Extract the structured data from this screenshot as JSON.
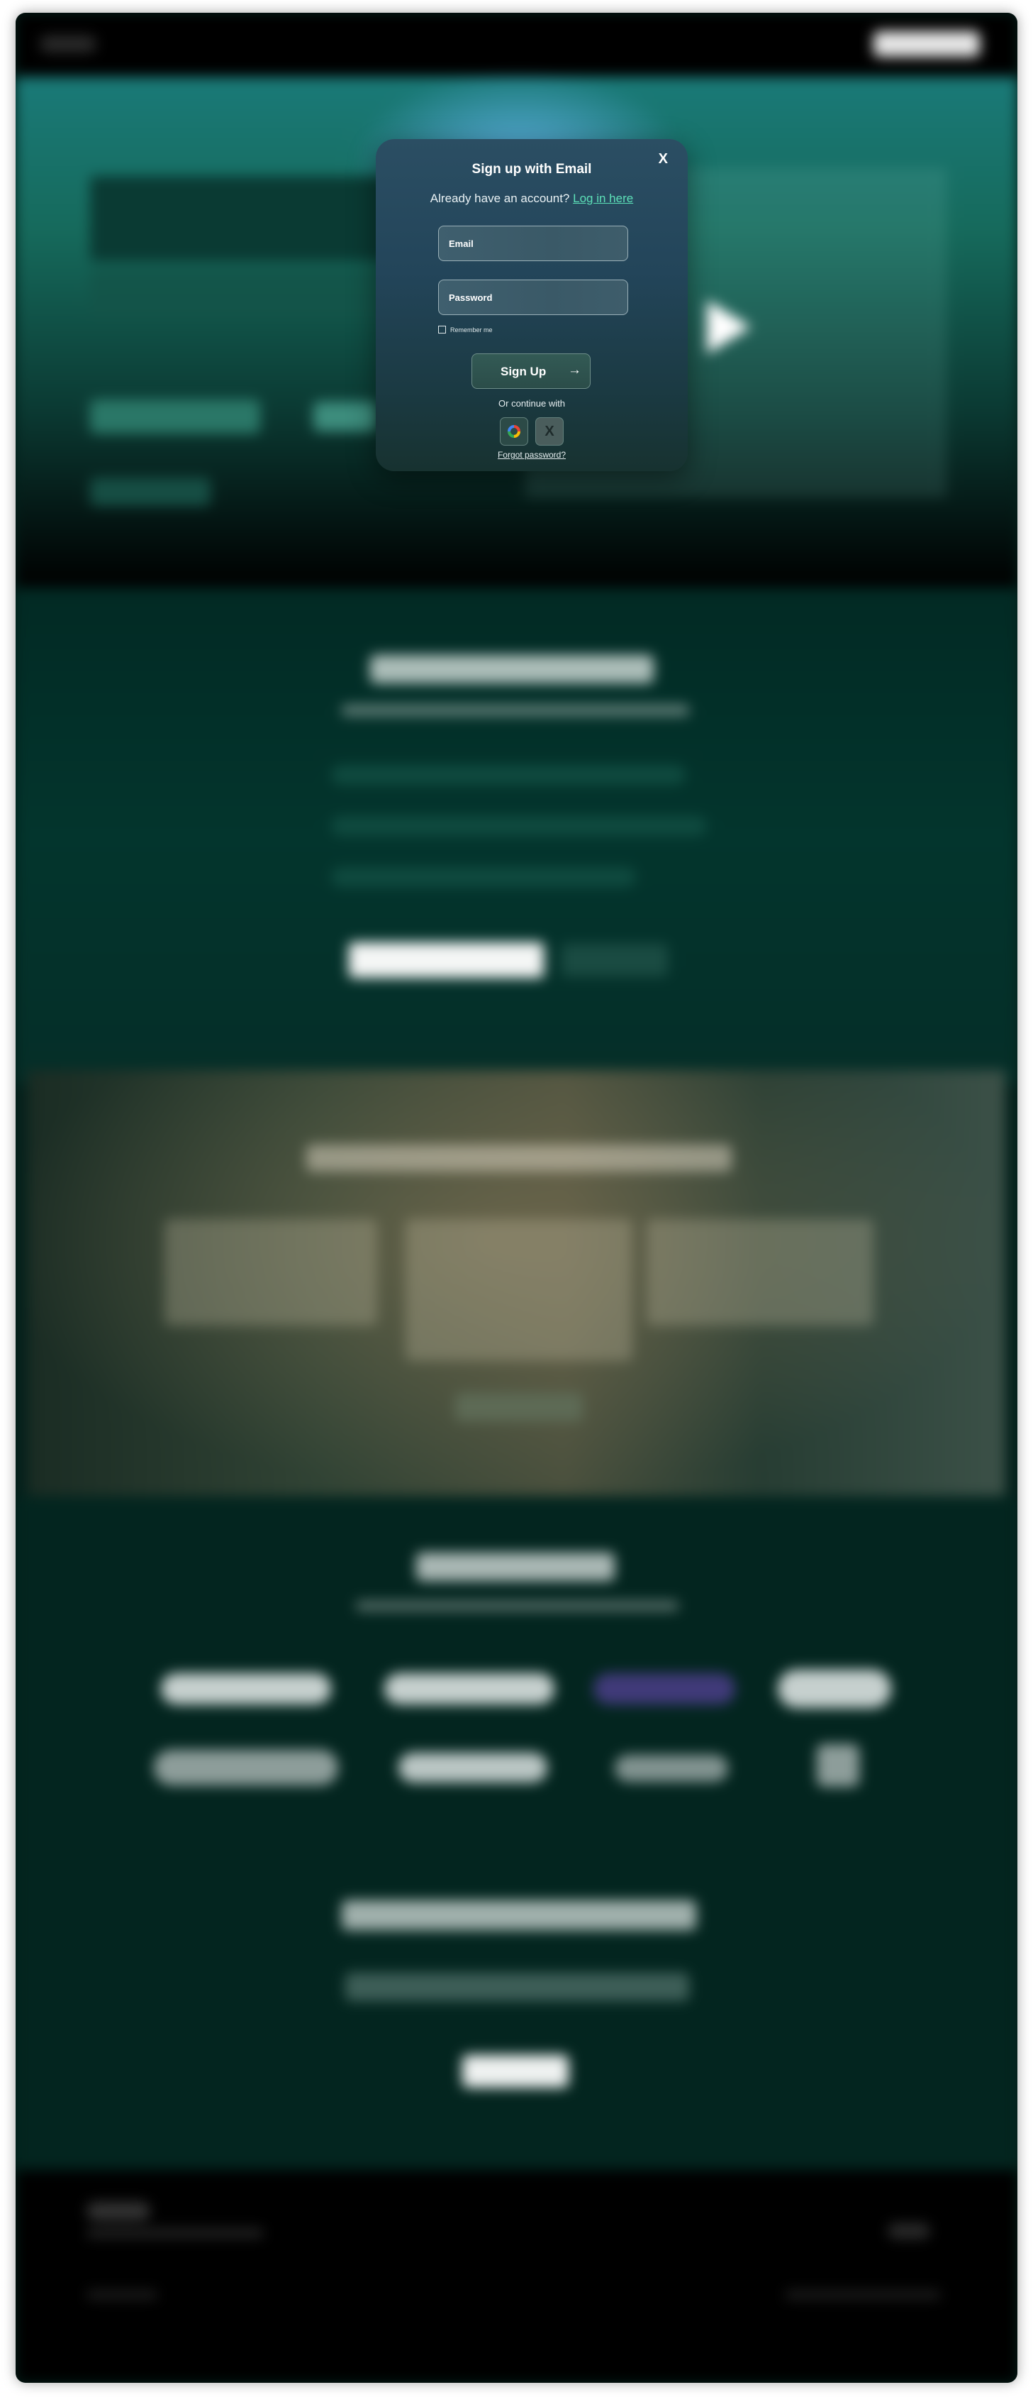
{
  "modal": {
    "title": "Sign up with Email",
    "close_label": "X",
    "login_prompt": "Already have an account?",
    "login_link": "Log in here",
    "email_placeholder": "Email",
    "password_placeholder": "Password",
    "remember_label": "Remember me",
    "signup_label": "Sign Up",
    "signup_arrow": "→",
    "or_continue": "Or continue with",
    "forgot_password": "Forgot password?",
    "social_icons": [
      "google-icon",
      "x-icon"
    ],
    "x_glyph": "X"
  },
  "colors": {
    "modal_top": "#2b4e63",
    "modal_bottom": "#173230",
    "link_accent": "#5de0b8",
    "page_dark": "#04201b"
  }
}
